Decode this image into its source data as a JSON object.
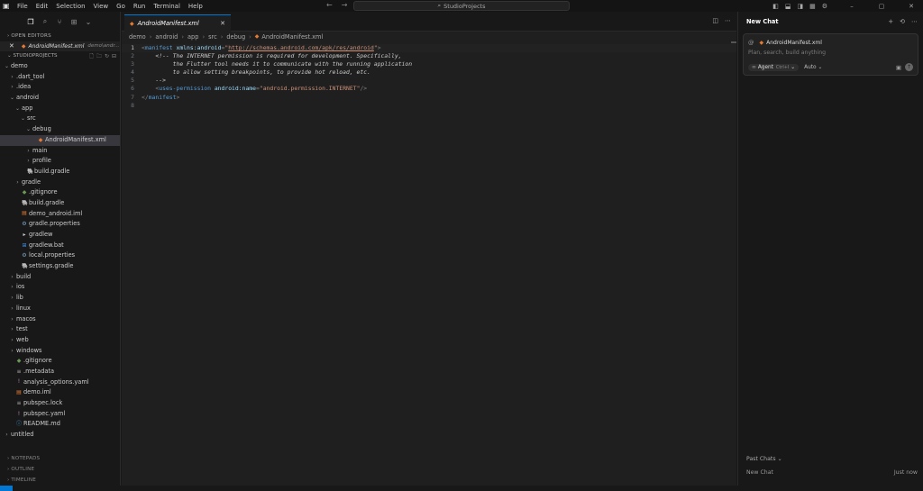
{
  "titlebar": {
    "menu": [
      "File",
      "Edit",
      "Selection",
      "View",
      "Go",
      "Run",
      "Terminal",
      "Help"
    ],
    "command_center": "StudioProjects",
    "logo_icon": "cursor-logo-icon"
  },
  "sidebar": {
    "open_editors_label": "OPEN EDITORS",
    "open_editor": {
      "name": "AndroidManifest.xml",
      "path": "demo\\andr..."
    },
    "project_label": "STUDIOPROJECTS",
    "tree": [
      {
        "label": "demo",
        "depth": 0,
        "type": "folder-open"
      },
      {
        "label": ".dart_tool",
        "depth": 1,
        "type": "folder"
      },
      {
        "label": ".idea",
        "depth": 1,
        "type": "folder"
      },
      {
        "label": "android",
        "depth": 1,
        "type": "folder-open"
      },
      {
        "label": "app",
        "depth": 2,
        "type": "folder-open"
      },
      {
        "label": "src",
        "depth": 3,
        "type": "folder-open"
      },
      {
        "label": "debug",
        "depth": 4,
        "type": "folder-open"
      },
      {
        "label": "AndroidManifest.xml",
        "depth": 5,
        "type": "file",
        "icon": "xml",
        "selected": true
      },
      {
        "label": "main",
        "depth": 4,
        "type": "folder"
      },
      {
        "label": "profile",
        "depth": 4,
        "type": "folder"
      },
      {
        "label": "build.gradle",
        "depth": 3,
        "type": "file",
        "icon": "gradle"
      },
      {
        "label": "gradle",
        "depth": 2,
        "type": "folder"
      },
      {
        "label": ".gitignore",
        "depth": 2,
        "type": "file",
        "icon": "git"
      },
      {
        "label": "build.gradle",
        "depth": 2,
        "type": "file",
        "icon": "gradle"
      },
      {
        "label": "demo_android.iml",
        "depth": 2,
        "type": "file",
        "icon": "iml"
      },
      {
        "label": "gradle.properties",
        "depth": 2,
        "type": "file",
        "icon": "props"
      },
      {
        "label": "gradlew",
        "depth": 2,
        "type": "file",
        "icon": "term"
      },
      {
        "label": "gradlew.bat",
        "depth": 2,
        "type": "file",
        "icon": "win"
      },
      {
        "label": "local.properties",
        "depth": 2,
        "type": "file",
        "icon": "gear"
      },
      {
        "label": "settings.gradle",
        "depth": 2,
        "type": "file",
        "icon": "gradle"
      },
      {
        "label": "build",
        "depth": 1,
        "type": "folder"
      },
      {
        "label": "ios",
        "depth": 1,
        "type": "folder"
      },
      {
        "label": "lib",
        "depth": 1,
        "type": "folder"
      },
      {
        "label": "linux",
        "depth": 1,
        "type": "folder"
      },
      {
        "label": "macos",
        "depth": 1,
        "type": "folder"
      },
      {
        "label": "test",
        "depth": 1,
        "type": "folder"
      },
      {
        "label": "web",
        "depth": 1,
        "type": "folder"
      },
      {
        "label": "windows",
        "depth": 1,
        "type": "folder"
      },
      {
        "label": ".gitignore",
        "depth": 1,
        "type": "file",
        "icon": "git"
      },
      {
        "label": ".metadata",
        "depth": 1,
        "type": "file",
        "icon": "eq"
      },
      {
        "label": "analysis_options.yaml",
        "depth": 1,
        "type": "file",
        "icon": "yaml"
      },
      {
        "label": "demo.iml",
        "depth": 1,
        "type": "file",
        "icon": "iml"
      },
      {
        "label": "pubspec.lock",
        "depth": 1,
        "type": "file",
        "icon": "eq"
      },
      {
        "label": "pubspec.yaml",
        "depth": 1,
        "type": "file",
        "icon": "yaml"
      },
      {
        "label": "README.md",
        "depth": 1,
        "type": "file",
        "icon": "md"
      },
      {
        "label": "untitled",
        "depth": 0,
        "type": "folder"
      }
    ],
    "bottom_sections": [
      "NOTEPADS",
      "OUTLINE",
      "TIMELINE"
    ]
  },
  "editor": {
    "tab": {
      "name": "AndroidManifest.xml"
    },
    "breadcrumb": [
      "demo",
      "android",
      "app",
      "src",
      "debug",
      "AndroidManifest.xml"
    ],
    "line_numbers": [
      "1",
      "2",
      "3",
      "4",
      "5",
      "6",
      "7",
      "8"
    ],
    "current_line": 1,
    "code": {
      "l1_open": "<",
      "l1_tag": "manifest",
      "l1_attr": " xmlns:android",
      "l1_eq": "=",
      "l1_q1": "\"",
      "l1_url": "http://schemas.android.com/apk/res/android",
      "l1_q2": "\"",
      "l1_close": ">",
      "l2": "    <!-- The INTERNET permission is required for development. Specifically,",
      "l3": "         the Flutter tool needs it to communicate with the running application",
      "l4": "         to allow setting breakpoints, to provide hot reload, etc.",
      "l5": "    -->",
      "l6_indent": "    ",
      "l6_open": "<",
      "l6_tag": "uses-permission",
      "l6_attr": " android:name",
      "l6_eq": "=",
      "l6_str": "\"android.permission.INTERNET\"",
      "l6_close": "/>",
      "l7_open": "</",
      "l7_tag": "manifest",
      "l7_close": ">",
      "l8": ""
    }
  },
  "chat": {
    "title": "New Chat",
    "context_file": "AndroidManifest.xml",
    "placeholder": "Plan, search, build anything",
    "agent_label": "Agent",
    "agent_shortcut": "Ctrl+I",
    "model_label": "Auto",
    "past_chats_label": "Past Chats",
    "past_chats": [
      {
        "title": "New Chat",
        "time": "Just now"
      }
    ]
  },
  "colors": {
    "accent": "#0078d4",
    "xml_icon": "#e37933",
    "tag": "#569cd6",
    "attr": "#9cdcfe",
    "string": "#ce9178",
    "comment": "#6a9955"
  }
}
